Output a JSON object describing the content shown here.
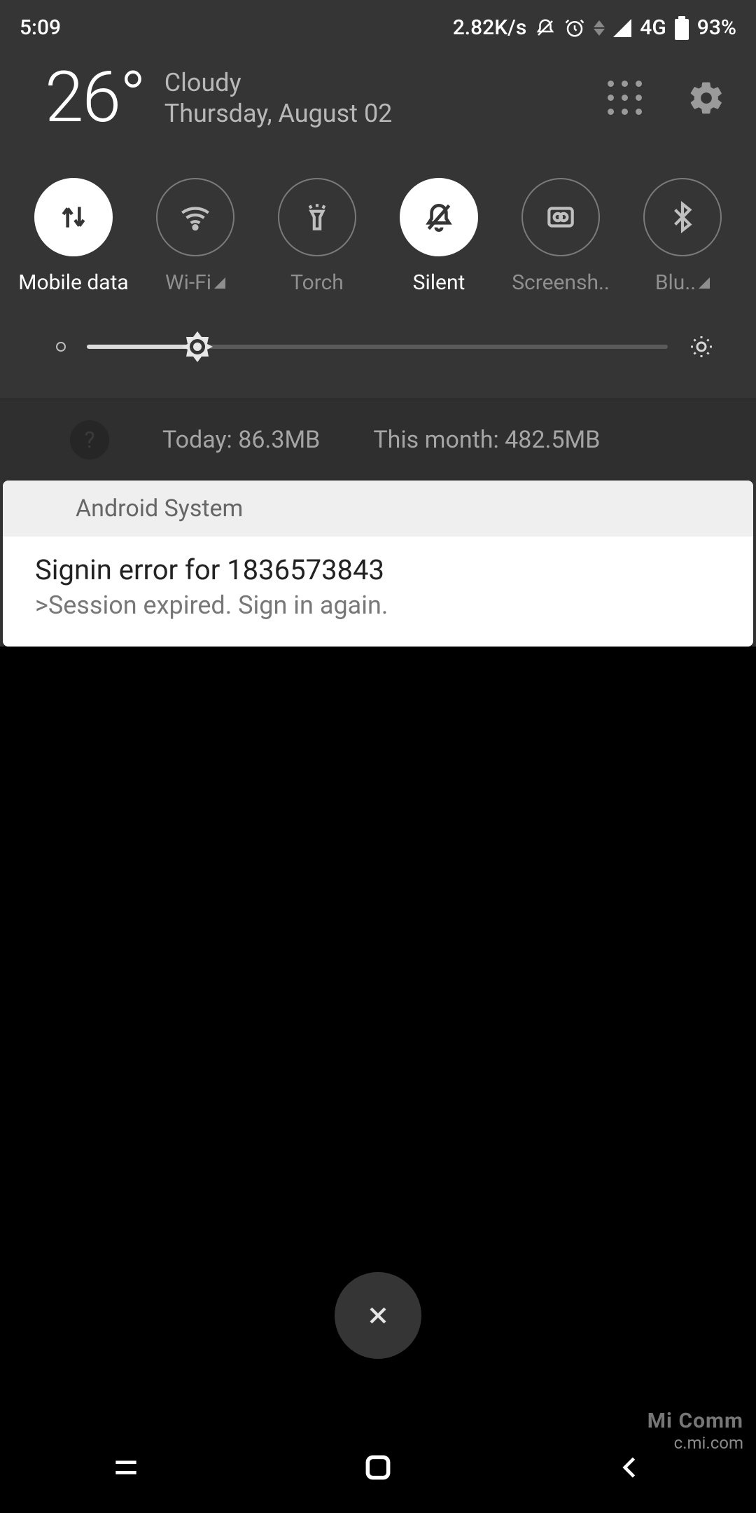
{
  "status": {
    "time": "5:09",
    "speed": "2.82K/s",
    "network": "4G",
    "battery": "93%"
  },
  "weather": {
    "temp": "26°",
    "condition": "Cloudy",
    "date": "Thursday, August 02"
  },
  "toggles": [
    {
      "label": "Mobile data",
      "active": true,
      "expand": false
    },
    {
      "label": "Wi-Fi",
      "active": false,
      "expand": true
    },
    {
      "label": "Torch",
      "active": false,
      "expand": false
    },
    {
      "label": "Silent",
      "active": true,
      "expand": false
    },
    {
      "label": "Screensh..",
      "active": false,
      "expand": false
    },
    {
      "label": "Blu..",
      "active": false,
      "expand": true
    }
  ],
  "data_usage": {
    "today": "Today: 86.3MB",
    "month": "This month: 482.5MB"
  },
  "notification": {
    "app": "Android System",
    "title": "Signin error for 1836573843",
    "subtitle": ">Session expired. Sign in again."
  },
  "watermark": {
    "line1": "Mi Comm",
    "line2": "c.mi.com"
  }
}
